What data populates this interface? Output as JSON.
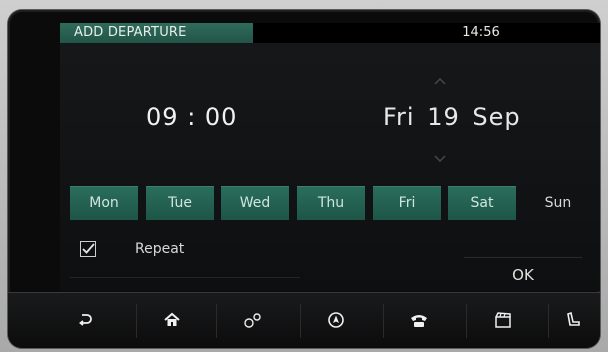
{
  "header": {
    "title": "ADD DEPARTURE",
    "clock": "14:56"
  },
  "departure": {
    "hour": "09",
    "minute": "00",
    "day_name": "Fri",
    "day_number": "19",
    "month": "Sep"
  },
  "days": [
    {
      "label": "Mon",
      "selected": true
    },
    {
      "label": "Tue",
      "selected": true
    },
    {
      "label": "Wed",
      "selected": true
    },
    {
      "label": "Thu",
      "selected": true
    },
    {
      "label": "Fri",
      "selected": true
    },
    {
      "label": "Sat",
      "selected": true
    },
    {
      "label": "Sun",
      "selected": false
    }
  ],
  "repeat": {
    "label": "Repeat",
    "checked": true
  },
  "ok_label": "OK",
  "nav": [
    {
      "icon": "back-icon"
    },
    {
      "icon": "home-icon"
    },
    {
      "icon": "connectivity-icon"
    },
    {
      "icon": "navigation-icon"
    },
    {
      "icon": "phone-icon"
    },
    {
      "icon": "media-icon"
    },
    {
      "icon": "seat-icon"
    }
  ],
  "colors": {
    "accent_green": "#2b6e5d",
    "background": "#0e0f10"
  }
}
